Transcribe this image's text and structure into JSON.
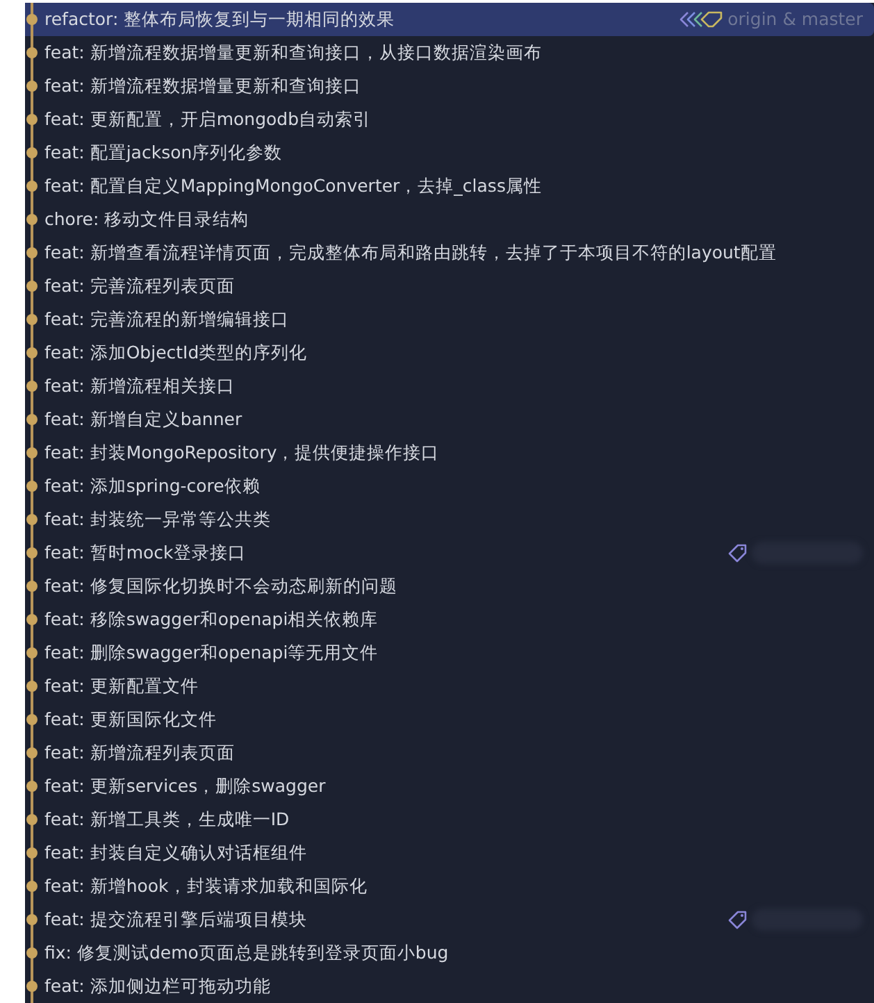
{
  "commits": [
    {
      "message": "refactor: 整体布局恢复到与一期相同的效果",
      "selected": true,
      "refs": {
        "label": "origin & master"
      }
    },
    {
      "message": "feat: 新增流程数据增量更新和查询接口，从接口数据渲染画布",
      "selected": false
    },
    {
      "message": "feat: 新增流程数据增量更新和查询接口",
      "selected": false
    },
    {
      "message": "feat: 更新配置，开启mongodb自动索引",
      "selected": false
    },
    {
      "message": "feat: 配置jackson序列化参数",
      "selected": false
    },
    {
      "message": "feat: 配置自定义MappingMongoConverter，去掉_class属性",
      "selected": false
    },
    {
      "message": "chore: 移动文件目录结构",
      "selected": false
    },
    {
      "message": "feat: 新增查看流程详情页面，完成整体布局和路由跳转，去掉了于本项目不符的layout配置",
      "selected": false
    },
    {
      "message": "feat: 完善流程列表页面",
      "selected": false
    },
    {
      "message": "feat: 完善流程的新增编辑接口",
      "selected": false
    },
    {
      "message": "feat: 添加ObjectId类型的序列化",
      "selected": false
    },
    {
      "message": "feat: 新增流程相关接口",
      "selected": false
    },
    {
      "message": "feat: 新增自定义banner",
      "selected": false
    },
    {
      "message": "feat: 封装MongoRepository，提供便捷操作接口",
      "selected": false
    },
    {
      "message": "feat: 添加spring-core依赖",
      "selected": false
    },
    {
      "message": "feat: 封装统一异常等公共类",
      "selected": false
    },
    {
      "message": "feat: 暂时mock登录接口",
      "selected": false,
      "tagged": true
    },
    {
      "message": "feat: 修复国际化切换时不会动态刷新的问题",
      "selected": false
    },
    {
      "message": "feat: 移除swagger和openapi相关依赖库",
      "selected": false
    },
    {
      "message": "feat: 删除swagger和openapi等无用文件",
      "selected": false
    },
    {
      "message": "feat: 更新配置文件",
      "selected": false
    },
    {
      "message": "feat: 更新国际化文件",
      "selected": false
    },
    {
      "message": "feat: 新增流程列表页面",
      "selected": false
    },
    {
      "message": "feat: 更新services，删除swagger",
      "selected": false
    },
    {
      "message": "feat: 新增工具类，生成唯一ID",
      "selected": false
    },
    {
      "message": "feat: 封装自定义确认对话框组件",
      "selected": false
    },
    {
      "message": "feat: 新增hook，封装请求加载和国际化",
      "selected": false
    },
    {
      "message": "feat: 提交流程引擎后端项目模块",
      "selected": false,
      "tagged": true
    },
    {
      "message": "fix: 修复测试demo页面总是跳转到登录页面小bug",
      "selected": false
    },
    {
      "message": "feat: 添加侧边栏可拖动功能",
      "selected": false
    }
  ]
}
